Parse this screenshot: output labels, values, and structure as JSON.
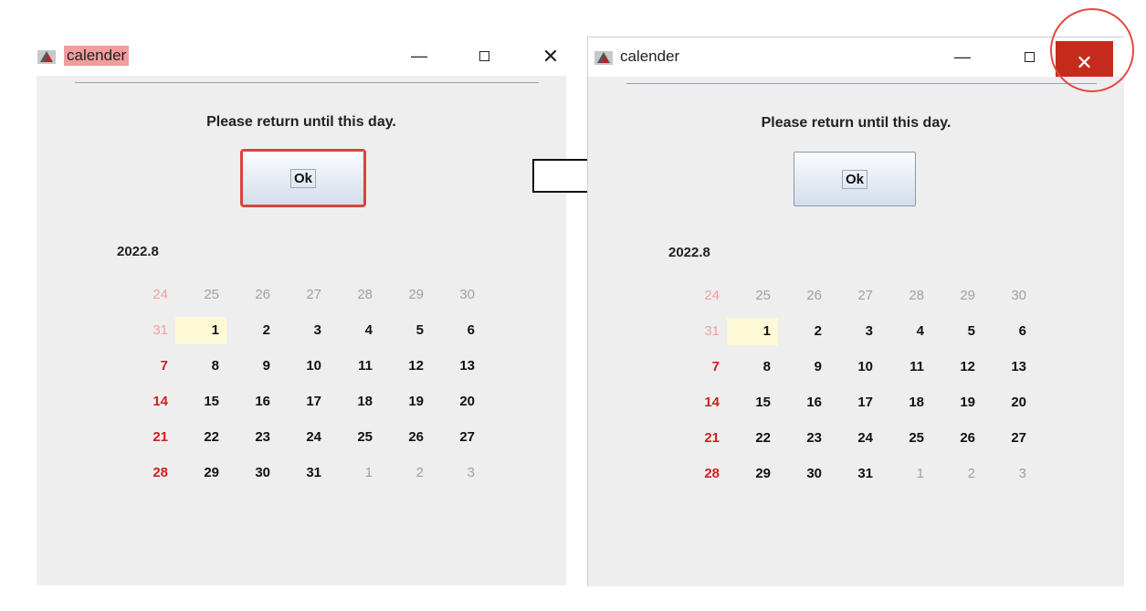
{
  "windows": [
    {
      "id": "before",
      "title": "calender",
      "minimize": "—",
      "close": "✕",
      "message": "Please return until this day.",
      "ok_label": "Ok",
      "month": "2022.8"
    },
    {
      "id": "after",
      "title": "calender",
      "minimize": "—",
      "close": "✕",
      "message": "Please return until this day.",
      "ok_label": "Ok",
      "month": "2022.8"
    }
  ],
  "calendar": {
    "weeks": [
      [
        {
          "d": "24",
          "t": "other-sun"
        },
        {
          "d": "25",
          "t": "other"
        },
        {
          "d": "26",
          "t": "other"
        },
        {
          "d": "27",
          "t": "other"
        },
        {
          "d": "28",
          "t": "other"
        },
        {
          "d": "29",
          "t": "other"
        },
        {
          "d": "30",
          "t": "other"
        }
      ],
      [
        {
          "d": "31",
          "t": "other-sun"
        },
        {
          "d": "1",
          "t": "today"
        },
        {
          "d": "2",
          "t": "cur"
        },
        {
          "d": "3",
          "t": "cur"
        },
        {
          "d": "4",
          "t": "cur"
        },
        {
          "d": "5",
          "t": "cur"
        },
        {
          "d": "6",
          "t": "cur"
        }
      ],
      [
        {
          "d": "7",
          "t": "sun"
        },
        {
          "d": "8",
          "t": "cur"
        },
        {
          "d": "9",
          "t": "cur"
        },
        {
          "d": "10",
          "t": "cur"
        },
        {
          "d": "11",
          "t": "cur"
        },
        {
          "d": "12",
          "t": "cur"
        },
        {
          "d": "13",
          "t": "cur"
        }
      ],
      [
        {
          "d": "14",
          "t": "sun"
        },
        {
          "d": "15",
          "t": "cur"
        },
        {
          "d": "16",
          "t": "cur"
        },
        {
          "d": "17",
          "t": "cur"
        },
        {
          "d": "18",
          "t": "cur"
        },
        {
          "d": "19",
          "t": "cur"
        },
        {
          "d": "20",
          "t": "cur"
        }
      ],
      [
        {
          "d": "21",
          "t": "sun"
        },
        {
          "d": "22",
          "t": "cur"
        },
        {
          "d": "23",
          "t": "cur"
        },
        {
          "d": "24",
          "t": "cur"
        },
        {
          "d": "25",
          "t": "cur"
        },
        {
          "d": "26",
          "t": "cur"
        },
        {
          "d": "27",
          "t": "cur"
        }
      ],
      [
        {
          "d": "28",
          "t": "sun"
        },
        {
          "d": "29",
          "t": "cur"
        },
        {
          "d": "30",
          "t": "cur"
        },
        {
          "d": "31",
          "t": "cur"
        },
        {
          "d": "1",
          "t": "other"
        },
        {
          "d": "2",
          "t": "other"
        },
        {
          "d": "3",
          "t": "other"
        }
      ]
    ]
  },
  "colors": {
    "sunday": "#d11f1f",
    "highlight": "#d9443b",
    "close_active": "#c42b1c",
    "today_bg": "#fdf9d6"
  },
  "icons": {
    "app": "java-app-icon",
    "transition": "right-arrow"
  }
}
